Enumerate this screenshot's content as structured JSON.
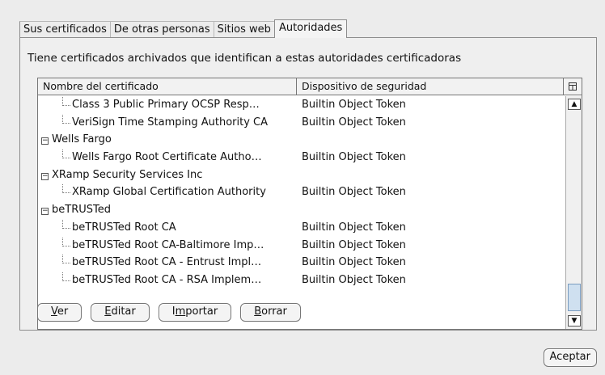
{
  "tabs": [
    "Sus certificados",
    "De otras personas",
    "Sitios web",
    "Autoridades"
  ],
  "description": "Tiene certificados archivados que identifican a estas autoridades certificadoras",
  "table": {
    "columns": [
      "Nombre del certificado",
      "Dispositivo de seguridad"
    ],
    "column_picker_icon": "column-picker-icon",
    "rows": [
      {
        "type": "child",
        "name": "Class 3 Public Primary OCSP Resp…",
        "device": "Builtin Object Token"
      },
      {
        "type": "child",
        "name": "VeriSign Time Stamping Authority CA",
        "device": "Builtin Object Token"
      },
      {
        "type": "parent",
        "name": "Wells Fargo",
        "device": ""
      },
      {
        "type": "child",
        "name": "Wells Fargo Root Certificate Autho…",
        "device": "Builtin Object Token"
      },
      {
        "type": "parent",
        "name": "XRamp Security Services Inc",
        "device": ""
      },
      {
        "type": "child",
        "name": "XRamp Global Certification Authority",
        "device": "Builtin Object Token"
      },
      {
        "type": "parent",
        "name": "beTRUSTed",
        "device": ""
      },
      {
        "type": "child",
        "name": "beTRUSTed Root CA",
        "device": "Builtin Object Token"
      },
      {
        "type": "child",
        "name": "beTRUSTed Root CA-Baltimore Imp…",
        "device": "Builtin Object Token"
      },
      {
        "type": "child",
        "name": "beTRUSTed Root CA - Entrust Impl…",
        "device": "Builtin Object Token"
      },
      {
        "type": "child",
        "name": "beTRUSTed Root CA - RSA Implem…",
        "device": "Builtin Object Token"
      }
    ],
    "expander_glyph": "−"
  },
  "buttons": {
    "view": {
      "mnemonic": "V",
      "rest": "er"
    },
    "edit": {
      "mnemonic": "E",
      "rest": "ditar"
    },
    "import": {
      "pre": "I",
      "mnemonic": "m",
      "rest": "portar"
    },
    "delete": {
      "mnemonic": "B",
      "rest": "orrar"
    }
  },
  "ok_label": "Aceptar",
  "scrollbar": {
    "up_glyph": "▲",
    "down_glyph": "▼"
  }
}
